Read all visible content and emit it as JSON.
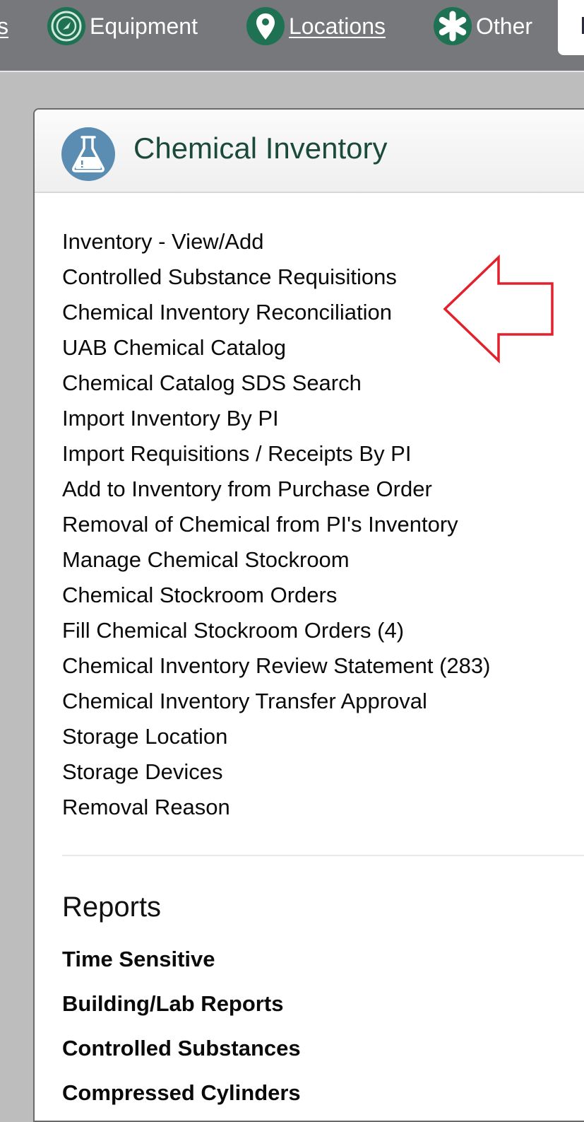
{
  "topnav": {
    "partial_item_label": "s",
    "items": [
      {
        "label": "Equipment",
        "icon": "gauge-icon",
        "underlined": false
      },
      {
        "label": "Locations",
        "icon": "map-pin-icon",
        "underlined": true
      },
      {
        "label": "Other",
        "icon": "asterisk-icon",
        "underlined": false
      }
    ],
    "icon_color": "#1e7253"
  },
  "card": {
    "title": "Chemical Inventory",
    "icon": "flask-icon",
    "icon_color": "#5b8db3",
    "title_color": "#1b4a3a",
    "links": [
      "Inventory - View/Add",
      "Controlled Substance Requisitions",
      "Chemical Inventory Reconciliation",
      "UAB Chemical Catalog",
      "Chemical Catalog SDS Search",
      "Import Inventory By PI",
      "Import Requisitions / Receipts By PI",
      "Add to Inventory from Purchase Order",
      "Removal of Chemical from PI's Inventory",
      "Manage Chemical Stockroom",
      "Chemical Stockroom Orders",
      "Fill Chemical Stockroom Orders (4)",
      "Chemical Inventory Review Statement (283)",
      "Chemical Inventory Transfer Approval",
      "Storage Location",
      "Storage Devices",
      "Removal Reason"
    ],
    "reports": {
      "title": "Reports",
      "items": [
        "Time Sensitive",
        "Building/Lab Reports",
        "Controlled Substances",
        "Compressed Cylinders"
      ]
    }
  },
  "annotation": {
    "type": "arrow-left",
    "target": "Chemical Inventory Reconciliation",
    "color": "#e3202b"
  }
}
